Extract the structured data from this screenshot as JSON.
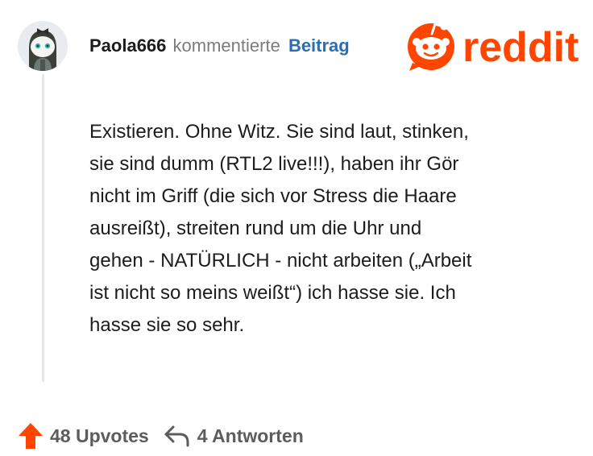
{
  "comment": {
    "author": "Paola666",
    "action_text": "kommentierte",
    "post_link": "Beitrag",
    "body": "Existieren. Ohne Witz. Sie sind laut, stinken,\nsie sind dumm (RTL2 live!!!), haben ihr Gör\nnicht im Griff (die sich vor Stress die Haare\nausreißt), streiten rund um die Uhr und\ngehen - NATÜRLICH - nicht arbeiten („Arbeit\nist nicht so meins weißt“) ich hasse sie. Ich\nhasse sie so sehr.",
    "upvotes": "48 Upvotes",
    "replies": "4 Antworten"
  },
  "brand": {
    "logo_text": "reddit",
    "color": "#ff4500"
  },
  "icons": {
    "avatar": "snoo-avatar",
    "logo": "reddit-snoo-logo",
    "upvote": "upvote-arrow-icon",
    "reply": "reply-arrow-icon"
  },
  "colors": {
    "upvote": "#ff4500",
    "link": "#2a6fb5",
    "muted": "#7c7c7c",
    "thread_line": "#e4e6e8"
  }
}
